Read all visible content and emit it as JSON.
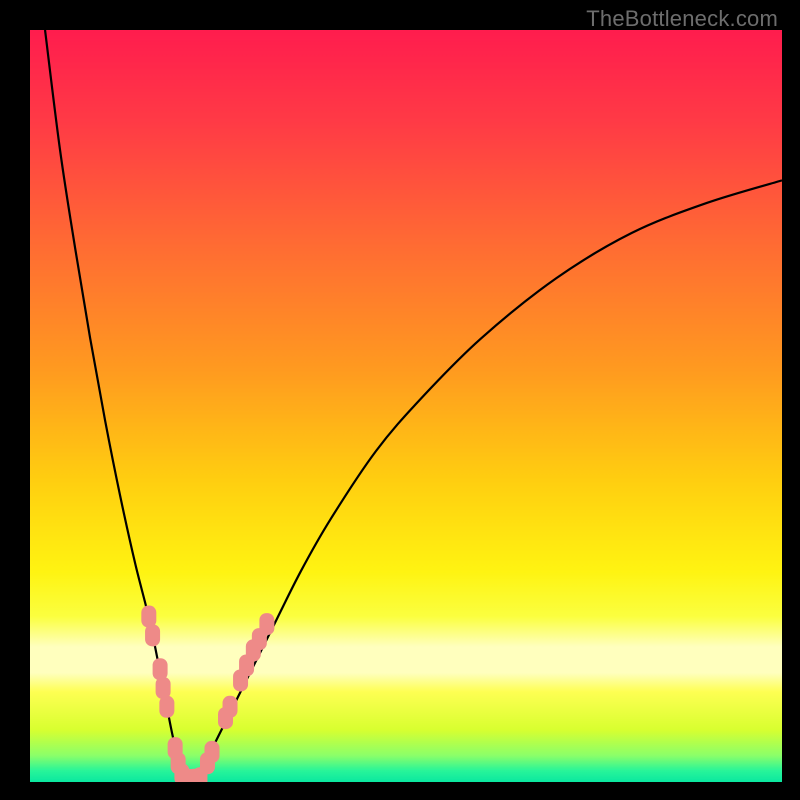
{
  "watermark": "TheBottleneck.com",
  "chart_data": {
    "type": "line",
    "title": "",
    "xlabel": "",
    "ylabel": "",
    "xlim": [
      0,
      100
    ],
    "ylim": [
      0,
      100
    ],
    "series": [
      {
        "name": "bottleneck-curve",
        "x": [
          2,
          4,
          6,
          8,
          10,
          12,
          14,
          16,
          18,
          19,
          20,
          21,
          22,
          23,
          25,
          28,
          32,
          36,
          40,
          46,
          52,
          60,
          70,
          80,
          90,
          100
        ],
        "values": [
          100,
          84,
          71,
          59,
          48,
          38,
          29,
          21,
          11,
          6,
          2,
          0,
          0,
          2,
          6,
          12,
          20,
          28,
          35,
          44,
          51,
          59,
          67,
          73,
          77,
          80
        ]
      }
    ],
    "markers": {
      "name": "highlight-dots",
      "color": "#ee8a88",
      "points": [
        {
          "x": 15.8,
          "y": 22.0
        },
        {
          "x": 16.3,
          "y": 19.5
        },
        {
          "x": 17.3,
          "y": 15.0
        },
        {
          "x": 17.7,
          "y": 12.5
        },
        {
          "x": 18.2,
          "y": 10.0
        },
        {
          "x": 19.3,
          "y": 4.5
        },
        {
          "x": 19.7,
          "y": 2.5
        },
        {
          "x": 20.2,
          "y": 1.0
        },
        {
          "x": 21.0,
          "y": 0.3
        },
        {
          "x": 21.8,
          "y": 0.3
        },
        {
          "x": 22.6,
          "y": 0.5
        },
        {
          "x": 23.6,
          "y": 2.5
        },
        {
          "x": 24.2,
          "y": 4.0
        },
        {
          "x": 26.0,
          "y": 8.5
        },
        {
          "x": 26.6,
          "y": 10.0
        },
        {
          "x": 28.0,
          "y": 13.5
        },
        {
          "x": 28.8,
          "y": 15.5
        },
        {
          "x": 29.7,
          "y": 17.5
        },
        {
          "x": 30.5,
          "y": 19.0
        },
        {
          "x": 31.5,
          "y": 21.0
        }
      ]
    },
    "gradient": {
      "stops": [
        {
          "t": 0.0,
          "color": "#ff1d4e"
        },
        {
          "t": 0.12,
          "color": "#ff3a46"
        },
        {
          "t": 0.28,
          "color": "#ff6a34"
        },
        {
          "t": 0.45,
          "color": "#ff9a20"
        },
        {
          "t": 0.6,
          "color": "#ffcf10"
        },
        {
          "t": 0.72,
          "color": "#fff412"
        },
        {
          "t": 0.78,
          "color": "#fbff40"
        },
        {
          "t": 0.82,
          "color": "#ffffbe"
        },
        {
          "t": 0.855,
          "color": "#ffffbe"
        },
        {
          "t": 0.88,
          "color": "#feff53"
        },
        {
          "t": 0.93,
          "color": "#d9ff30"
        },
        {
          "t": 0.965,
          "color": "#8bff6a"
        },
        {
          "t": 0.985,
          "color": "#28f59a"
        },
        {
          "t": 1.0,
          "color": "#0be8a0"
        }
      ]
    }
  }
}
